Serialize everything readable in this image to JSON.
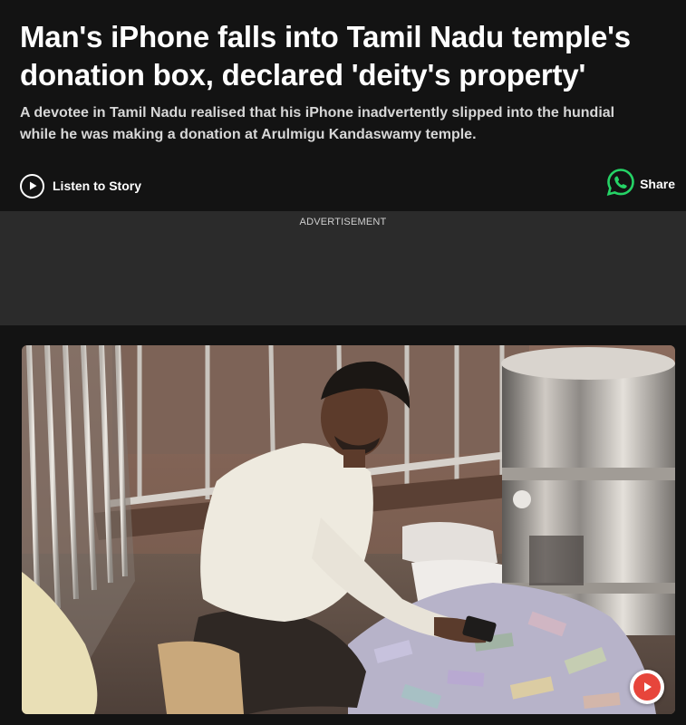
{
  "article": {
    "headline_line1": "Man's iPhone falls into Tamil Nadu temple's",
    "headline_line2": "donation box, declared 'deity's property'",
    "summary_line1": "A devotee in Tamil Nadu realised that his iPhone inadvertently slipped into the hundial",
    "summary_line2": "while he was making a donation at Arulmigu Kandaswamy temple."
  },
  "actions": {
    "listen_label": "Listen to Story",
    "share_label": "Share",
    "listen_icon": "play-icon",
    "share_icon": "whatsapp-icon"
  },
  "advertisement": {
    "label": "ADVERTISEMENT"
  },
  "media": {
    "play_icon": "video-play-icon"
  },
  "colors": {
    "page_background": "#131313",
    "ad_background": "#2b2b2b",
    "whatsapp_green": "#25d366",
    "video_play_red": "#e7453b"
  }
}
